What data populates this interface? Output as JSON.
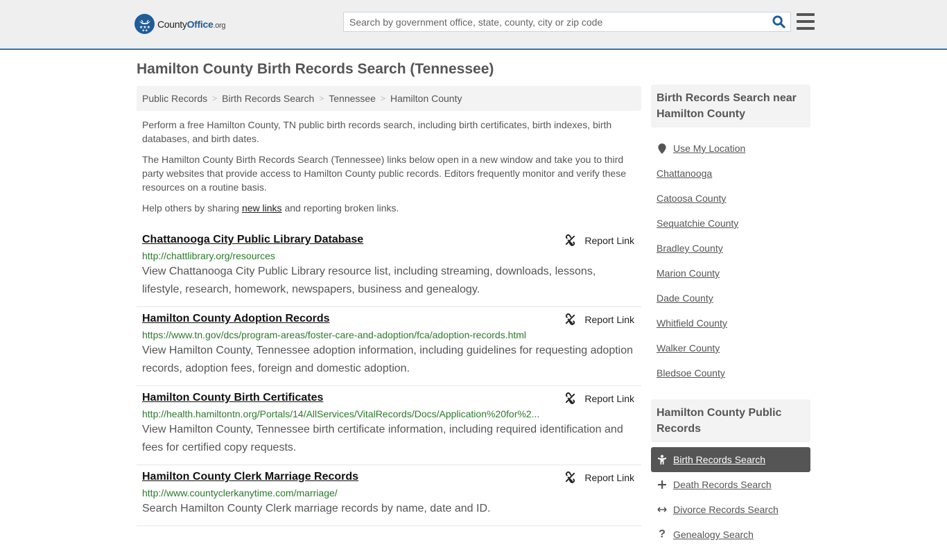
{
  "header": {
    "logo": {
      "name": "County",
      "office": "Office",
      "tld": ".org"
    },
    "search": {
      "placeholder": "Search by government office, state, county, city or zip code",
      "value": ""
    },
    "icons": {
      "search": "search-icon",
      "menu": "hamburger-menu-icon"
    }
  },
  "page": {
    "title": "Hamilton County Birth Records Search (Tennessee)"
  },
  "breadcrumb": [
    {
      "label": "Public Records"
    },
    {
      "label": "Birth Records Search"
    },
    {
      "label": "Tennessee"
    },
    {
      "label": "Hamilton County"
    }
  ],
  "intro": {
    "p1": "Perform a free Hamilton County, TN public birth records search, including birth certificates, birth indexes, birth databases, and birth dates.",
    "p2": "The Hamilton County Birth Records Search (Tennessee) links below open in a new window and take you to third party websites that provide access to Hamilton County public records. Editors frequently monitor and verify these resources on a routine basis.",
    "p3_before": "Help others by sharing ",
    "p3_link": "new links",
    "p3_after": " and reporting broken links."
  },
  "results": [
    {
      "title": "Chattanooga City Public Library Database",
      "url": "http://chattlibrary.org/resources",
      "description": "View Chattanooga City Public Library resource list, including streaming, downloads, lessons, lifestyle, research, homework, newspapers, business and genealogy.",
      "report_label": "Report Link"
    },
    {
      "title": "Hamilton County Adoption Records",
      "url": "https://www.tn.gov/dcs/program-areas/foster-care-and-adoption/fca/adoption-records.html",
      "description": "View Hamilton County, Tennessee adoption information, including guidelines for requesting adoption records, adoption fees, foreign and domestic adoption.",
      "report_label": "Report Link"
    },
    {
      "title": "Hamilton County Birth Certificates",
      "url": "http://health.hamiltontn.org/Portals/14/AllServices/VitalRecords/Docs/Application%20for%2...",
      "description": "View Hamilton County, Tennessee birth certificate information, including required identification and fees for certified copy requests.",
      "report_label": "Report Link"
    },
    {
      "title": "Hamilton County Clerk Marriage Records",
      "url": "http://www.countyclerkanytime.com/marriage/",
      "description": "Search Hamilton County Clerk marriage records by name, date and ID.",
      "report_label": "Report Link"
    }
  ],
  "sidebar": {
    "nearby_heading": "Birth Records Search near Hamilton County",
    "use_location": "Use My Location",
    "nearby": [
      "Chattanooga",
      "Catoosa County",
      "Sequatchie County",
      "Bradley County",
      "Marion County",
      "Dade County",
      "Whitfield County",
      "Walker County",
      "Bledsoe County"
    ],
    "public_heading": "Hamilton County Public Records",
    "public_records": [
      {
        "label": "Birth Records Search",
        "icon": "child-icon",
        "active": true
      },
      {
        "label": "Death Records Search",
        "icon": "plus-icon",
        "active": false
      },
      {
        "label": "Divorce Records Search",
        "icon": "arrows-horizontal-icon",
        "active": false
      },
      {
        "label": "Genealogy Search",
        "icon": "question-icon",
        "active": false
      }
    ]
  }
}
